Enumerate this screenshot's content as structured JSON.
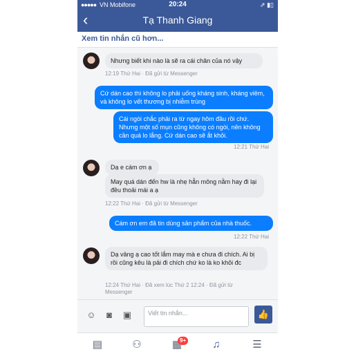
{
  "status": {
    "carrier": "VN Mobifone",
    "time": "20:24",
    "signal": "●●●●●",
    "right": "⇗ ▮▯"
  },
  "nav": {
    "title": "Tạ Thanh Giang",
    "back": "‹"
  },
  "older": "Xem tin nhắn cũ hơn...",
  "messages": {
    "m1": "Nhưng biết khi nào là sẽ ra cái chân của nó vậy",
    "meta1": "12:19 Thứ Hai · Đã gửi từ Messenger",
    "m2": "Cứ dán cao thì không lo phải uống kháng sinh, kháng viêm, và không lo vết thương bị nhiễm trùng",
    "m3": "Cái ngòi chắc phải ra từ ngay hôm đầu rồi chứ. Nhưng một số mụn cũng không có ngòi, nên không cần quá lo lắng. Cứ dán cao sẽ ắt khỏi.",
    "meta2": "12:21 Thứ Hai",
    "m4": "Dạ e cám ơn ạ",
    "m5": "May quá dán đến hw là nhẹ hẳn mông nằm hay đi lại đều thoải mái a ạ",
    "meta3": "12:22 Thứ Hai · Đã gửi từ Messenger",
    "m6": "Cám ơn em đã tin dùng sản phẩm của nhà thuốc.",
    "meta4": "12:22 Thứ Hai",
    "m7": "Dạ vâng ạ cao tốt lắm may mà e chưa đi chích. Ai bị rồi cũng kêu là pải đi chích chứ ko là ko khỏi đc",
    "meta5": "12:24 Thứ Hai · Đã xem lúc Thứ 2 12:24 · Đã gửi từ Messenger"
  },
  "composer": {
    "placeholder": "Viết tin nhắn...",
    "like": "👍"
  },
  "tabs": {
    "badge": "9+"
  },
  "colors": {
    "brand": "#3b5998",
    "bubble_out": "#0b7eff",
    "bubble_in": "#e9eaed"
  }
}
